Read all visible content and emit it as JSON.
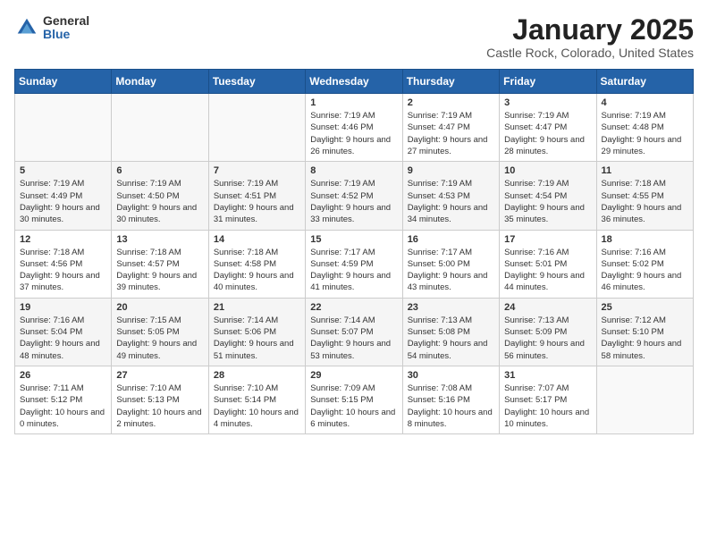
{
  "header": {
    "logo_general": "General",
    "logo_blue": "Blue",
    "title": "January 2025",
    "subtitle": "Castle Rock, Colorado, United States"
  },
  "weekdays": [
    "Sunday",
    "Monday",
    "Tuesday",
    "Wednesday",
    "Thursday",
    "Friday",
    "Saturday"
  ],
  "weeks": [
    [
      {
        "day": "",
        "info": ""
      },
      {
        "day": "",
        "info": ""
      },
      {
        "day": "",
        "info": ""
      },
      {
        "day": "1",
        "info": "Sunrise: 7:19 AM\nSunset: 4:46 PM\nDaylight: 9 hours and 26 minutes."
      },
      {
        "day": "2",
        "info": "Sunrise: 7:19 AM\nSunset: 4:47 PM\nDaylight: 9 hours and 27 minutes."
      },
      {
        "day": "3",
        "info": "Sunrise: 7:19 AM\nSunset: 4:47 PM\nDaylight: 9 hours and 28 minutes."
      },
      {
        "day": "4",
        "info": "Sunrise: 7:19 AM\nSunset: 4:48 PM\nDaylight: 9 hours and 29 minutes."
      }
    ],
    [
      {
        "day": "5",
        "info": "Sunrise: 7:19 AM\nSunset: 4:49 PM\nDaylight: 9 hours and 30 minutes."
      },
      {
        "day": "6",
        "info": "Sunrise: 7:19 AM\nSunset: 4:50 PM\nDaylight: 9 hours and 30 minutes."
      },
      {
        "day": "7",
        "info": "Sunrise: 7:19 AM\nSunset: 4:51 PM\nDaylight: 9 hours and 31 minutes."
      },
      {
        "day": "8",
        "info": "Sunrise: 7:19 AM\nSunset: 4:52 PM\nDaylight: 9 hours and 33 minutes."
      },
      {
        "day": "9",
        "info": "Sunrise: 7:19 AM\nSunset: 4:53 PM\nDaylight: 9 hours and 34 minutes."
      },
      {
        "day": "10",
        "info": "Sunrise: 7:19 AM\nSunset: 4:54 PM\nDaylight: 9 hours and 35 minutes."
      },
      {
        "day": "11",
        "info": "Sunrise: 7:18 AM\nSunset: 4:55 PM\nDaylight: 9 hours and 36 minutes."
      }
    ],
    [
      {
        "day": "12",
        "info": "Sunrise: 7:18 AM\nSunset: 4:56 PM\nDaylight: 9 hours and 37 minutes."
      },
      {
        "day": "13",
        "info": "Sunrise: 7:18 AM\nSunset: 4:57 PM\nDaylight: 9 hours and 39 minutes."
      },
      {
        "day": "14",
        "info": "Sunrise: 7:18 AM\nSunset: 4:58 PM\nDaylight: 9 hours and 40 minutes."
      },
      {
        "day": "15",
        "info": "Sunrise: 7:17 AM\nSunset: 4:59 PM\nDaylight: 9 hours and 41 minutes."
      },
      {
        "day": "16",
        "info": "Sunrise: 7:17 AM\nSunset: 5:00 PM\nDaylight: 9 hours and 43 minutes."
      },
      {
        "day": "17",
        "info": "Sunrise: 7:16 AM\nSunset: 5:01 PM\nDaylight: 9 hours and 44 minutes."
      },
      {
        "day": "18",
        "info": "Sunrise: 7:16 AM\nSunset: 5:02 PM\nDaylight: 9 hours and 46 minutes."
      }
    ],
    [
      {
        "day": "19",
        "info": "Sunrise: 7:16 AM\nSunset: 5:04 PM\nDaylight: 9 hours and 48 minutes."
      },
      {
        "day": "20",
        "info": "Sunrise: 7:15 AM\nSunset: 5:05 PM\nDaylight: 9 hours and 49 minutes."
      },
      {
        "day": "21",
        "info": "Sunrise: 7:14 AM\nSunset: 5:06 PM\nDaylight: 9 hours and 51 minutes."
      },
      {
        "day": "22",
        "info": "Sunrise: 7:14 AM\nSunset: 5:07 PM\nDaylight: 9 hours and 53 minutes."
      },
      {
        "day": "23",
        "info": "Sunrise: 7:13 AM\nSunset: 5:08 PM\nDaylight: 9 hours and 54 minutes."
      },
      {
        "day": "24",
        "info": "Sunrise: 7:13 AM\nSunset: 5:09 PM\nDaylight: 9 hours and 56 minutes."
      },
      {
        "day": "25",
        "info": "Sunrise: 7:12 AM\nSunset: 5:10 PM\nDaylight: 9 hours and 58 minutes."
      }
    ],
    [
      {
        "day": "26",
        "info": "Sunrise: 7:11 AM\nSunset: 5:12 PM\nDaylight: 10 hours and 0 minutes."
      },
      {
        "day": "27",
        "info": "Sunrise: 7:10 AM\nSunset: 5:13 PM\nDaylight: 10 hours and 2 minutes."
      },
      {
        "day": "28",
        "info": "Sunrise: 7:10 AM\nSunset: 5:14 PM\nDaylight: 10 hours and 4 minutes."
      },
      {
        "day": "29",
        "info": "Sunrise: 7:09 AM\nSunset: 5:15 PM\nDaylight: 10 hours and 6 minutes."
      },
      {
        "day": "30",
        "info": "Sunrise: 7:08 AM\nSunset: 5:16 PM\nDaylight: 10 hours and 8 minutes."
      },
      {
        "day": "31",
        "info": "Sunrise: 7:07 AM\nSunset: 5:17 PM\nDaylight: 10 hours and 10 minutes."
      },
      {
        "day": "",
        "info": ""
      }
    ]
  ]
}
